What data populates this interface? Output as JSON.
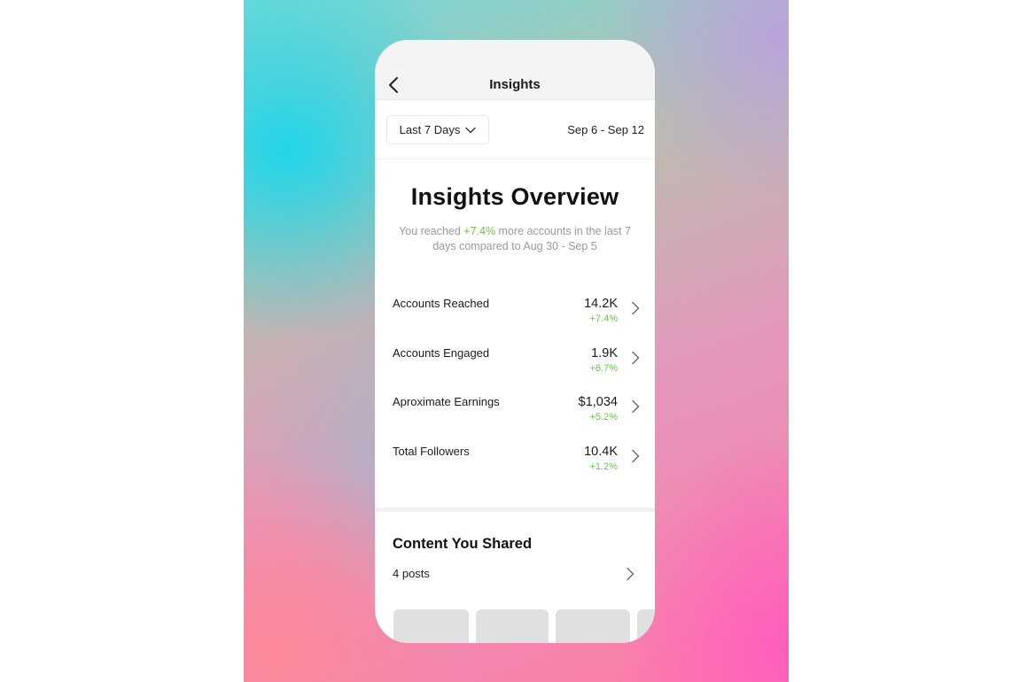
{
  "header": {
    "title": "Insights",
    "back_icon": "chevron-left-icon"
  },
  "filter": {
    "range_label": "Last 7 Days",
    "range_icon": "chevron-down-icon",
    "date_range": "Sep 6 - Sep 12"
  },
  "overview": {
    "title": "Insights Overview",
    "summary_prefix": "You reached ",
    "summary_highlight": "+7.4%",
    "summary_suffix": " more accounts in the last 7 days compared to Aug 30  - Sep 5"
  },
  "metrics": [
    {
      "label": "Accounts Reached",
      "value": "14.2K",
      "change": "+7.4%"
    },
    {
      "label": "Accounts Engaged",
      "value": "1.9K",
      "change": "+6.7%"
    },
    {
      "label": "Aproximate Earnings",
      "value": "$1,034",
      "change": "+5.2%"
    },
    {
      "label": "Total Followers",
      "value": "10.4K",
      "change": "+1.2%"
    }
  ],
  "content": {
    "title": "Content You Shared",
    "count": "4 posts",
    "thumbnail_count": 4
  },
  "colors": {
    "positive": "#6cc24a",
    "thumbnail": "#e0e0e0"
  }
}
